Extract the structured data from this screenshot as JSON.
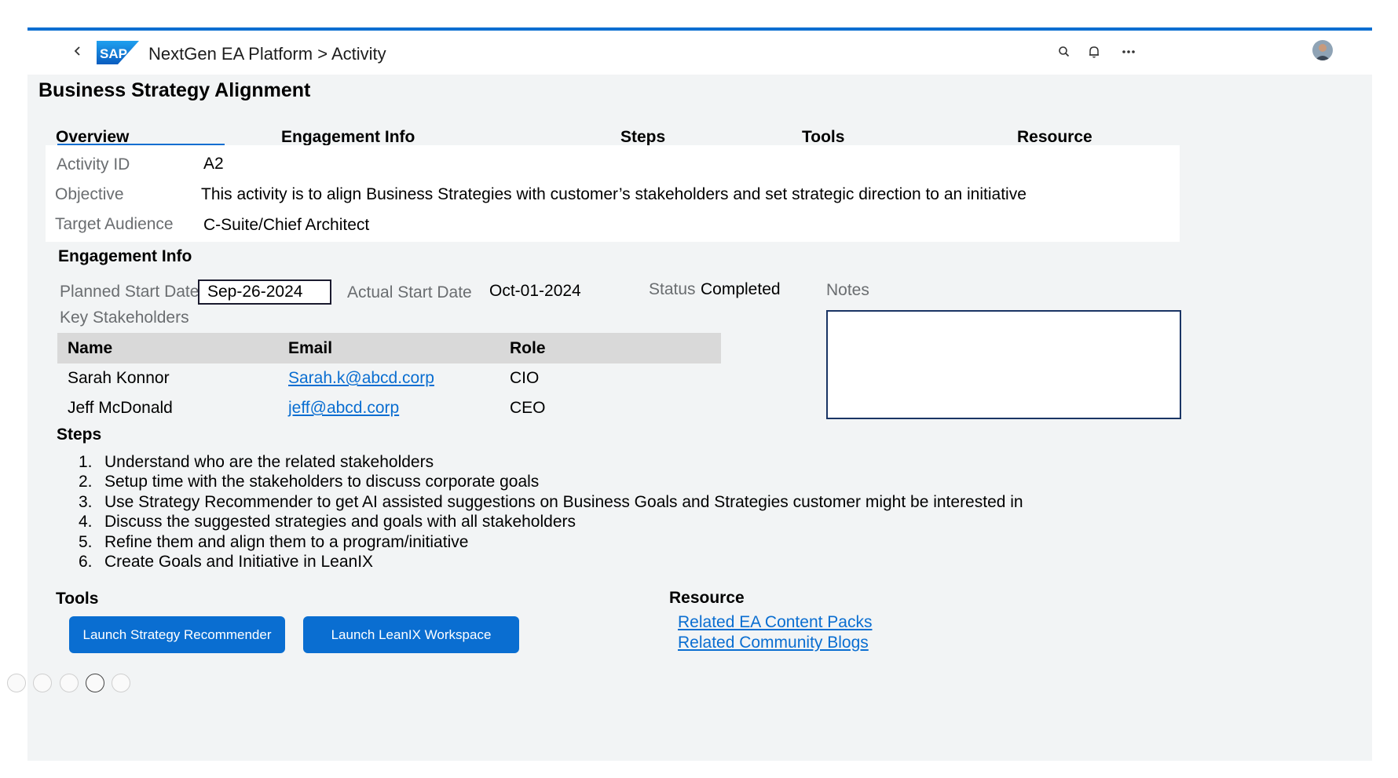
{
  "shell": {
    "app_title": "NextGen EA Platform > Activity",
    "icons": [
      "back-icon",
      "sap-logo",
      "search-icon",
      "bell-icon",
      "more-icon",
      "avatar"
    ]
  },
  "page": {
    "title": "Business Strategy Alignment"
  },
  "tabs": [
    {
      "label": "Overview",
      "selected": true
    },
    {
      "label": "Engagement Info",
      "selected": false
    },
    {
      "label": "Steps",
      "selected": false
    },
    {
      "label": "Tools",
      "selected": false
    },
    {
      "label": "Resource",
      "selected": false
    }
  ],
  "overview": {
    "activity_id_label": "Activity ID",
    "activity_id": "A2",
    "objective_label": "Objective",
    "objective": "This activity is to align Business Strategies with customer’s stakeholders and set strategic direction to an initiative",
    "audience_label": "Target Audience",
    "audience": "C-Suite/Chief Architect"
  },
  "engagement": {
    "heading": "Engagement Info",
    "planned_start_label": "Planned Start Date",
    "planned_start": "Sep-26-2024",
    "actual_start_label": "Actual Start Date",
    "actual_start": "Oct-01-2024",
    "status_label": "Status",
    "status": "Completed",
    "notes_label": "Notes",
    "notes_value": "",
    "stakeholders_label": "Key Stakeholders",
    "columns": [
      "Name",
      "Email",
      "Role"
    ],
    "rows": [
      {
        "name": "Sarah Konnor",
        "email": "Sarah.k@abcd.corp",
        "role": "CIO"
      },
      {
        "name": "Jeff McDonald",
        "email": "jeff@abcd.corp",
        "role": "CEO"
      }
    ]
  },
  "steps": {
    "heading": "Steps",
    "items": [
      {
        "num": "1.",
        "text": "Understand who are the related stakeholders"
      },
      {
        "num": "2.",
        "text": "Setup time with the stakeholders to discuss corporate goals"
      },
      {
        "num": "3.",
        "text": "Use Strategy Recommender to get AI assisted suggestions on Business Goals and Strategies customer might be interested in"
      },
      {
        "num": "4.",
        "text": "Discuss the suggested strategies and goals with all stakeholders"
      },
      {
        "num": "5.",
        "text": "Refine them and align them to a program/initiative"
      },
      {
        "num": "6.",
        "text": "Create Goals and Initiative in LeanIX"
      }
    ]
  },
  "tools": {
    "heading": "Tools",
    "buttons": [
      "Launch Strategy Recommender",
      "Launch LeanIX Workspace"
    ]
  },
  "resource": {
    "heading": "Resource",
    "links": [
      "Related EA Content Packs",
      "Related Community Blogs"
    ]
  },
  "colors": {
    "accent": "#0a6ed1",
    "page_bg": "#f2f4f5",
    "table_header_bg": "#d9d9d9",
    "label_gray": "#6a6d70"
  }
}
